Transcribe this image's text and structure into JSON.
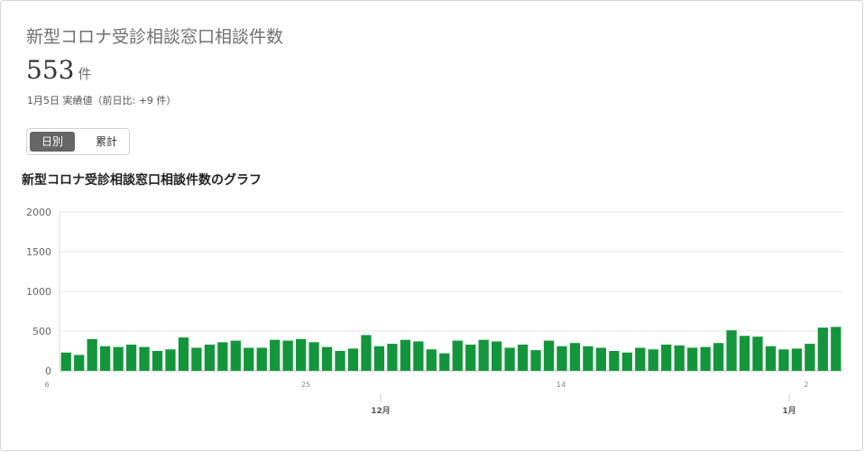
{
  "card": {
    "title": "新型コロナ受診相談窓口相談件数",
    "value": "553",
    "unit": "件",
    "note": "1月5日 実績値（前日比: +9 件）"
  },
  "toggle": {
    "daily_label": "日別",
    "cumulative_label": "累計",
    "selected": "日別"
  },
  "chart_data": {
    "type": "bar",
    "title": "新型コロナ受診相談窓口相談件数のグラフ",
    "bar_color": "#13963b",
    "ylim": [
      0,
      2000
    ],
    "yticks": [
      0,
      500,
      1000,
      1500,
      2000
    ],
    "ytick_labels": [
      "0",
      "500",
      "1000",
      "1500",
      "2000"
    ],
    "grid": true,
    "x_tick_labels": [
      {
        "index": 0,
        "label": "6"
      },
      {
        "index": 19,
        "label": "25"
      },
      {
        "index": 38,
        "label": "14"
      },
      {
        "index": 57,
        "label": "2"
      }
    ],
    "x_month_labels": [
      {
        "index": 25.5,
        "label": "12月"
      },
      {
        "index": 56.5,
        "label": "1月"
      }
    ],
    "values": [
      230,
      200,
      400,
      310,
      300,
      330,
      300,
      250,
      270,
      420,
      290,
      330,
      360,
      380,
      290,
      290,
      390,
      380,
      400,
      360,
      300,
      250,
      280,
      450,
      310,
      340,
      390,
      370,
      270,
      220,
      380,
      330,
      390,
      370,
      290,
      330,
      260,
      380,
      310,
      350,
      310,
      290,
      250,
      230,
      290,
      270,
      330,
      320,
      290,
      300,
      350,
      510,
      440,
      430,
      310,
      270,
      280,
      340,
      544,
      553
    ]
  }
}
